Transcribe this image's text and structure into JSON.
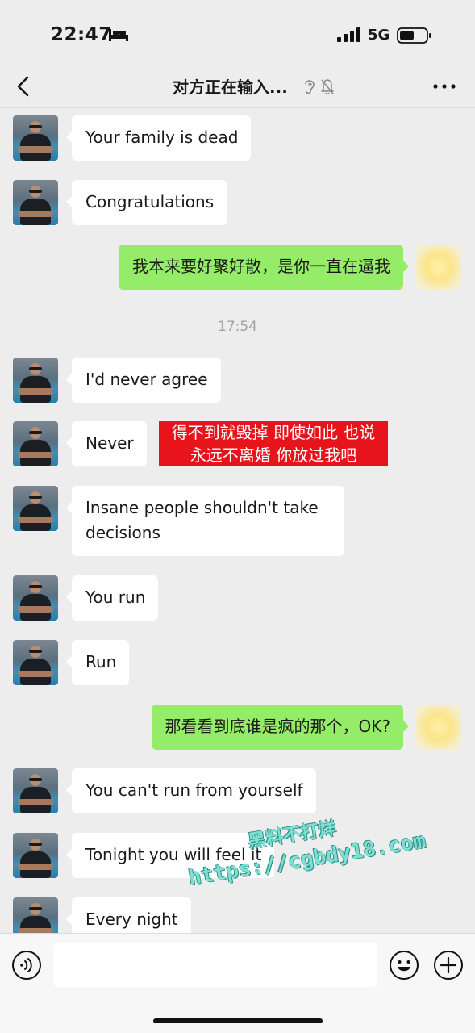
{
  "status_bar": {
    "time": "22:47",
    "network": "5G",
    "icons": [
      "bed-icon",
      "signal-icon",
      "battery-icon"
    ]
  },
  "nav": {
    "title": "对方正在输入...",
    "icons": [
      "back-icon",
      "ear-icon",
      "bell-mute-icon",
      "more-icon"
    ]
  },
  "messages": [
    {
      "side": "in",
      "text": "Your family is dead"
    },
    {
      "side": "in",
      "text": "Congratulations"
    },
    {
      "side": "out",
      "text": "我本来要好聚好散，是你一直在逼我"
    },
    {
      "side": "time",
      "text": "17:54"
    },
    {
      "side": "in",
      "text": "I'd never agree"
    },
    {
      "side": "in",
      "text": "Never"
    },
    {
      "side": "in",
      "text": "Insane people shouldn't take decisions"
    },
    {
      "side": "in",
      "text": "You run"
    },
    {
      "side": "in",
      "text": "Run"
    },
    {
      "side": "out",
      "text": "那看看到底谁是疯的那个，OK?"
    },
    {
      "side": "in",
      "text": "You can't run from yourself"
    },
    {
      "side": "in",
      "text": "Tonight you will feel it"
    },
    {
      "side": "in",
      "text": "Every night"
    }
  ],
  "overlay_caption": {
    "line1": "得不到就毁掉 即使如此 也说",
    "line2": "永远不离婚 你放过我吧"
  },
  "watermark": {
    "line1": "黑料不打烊",
    "line2": "https://cgbdy18.com"
  },
  "input_bar": {
    "placeholder": "",
    "icons": [
      "voice-icon",
      "emoji-icon",
      "plus-icon"
    ]
  },
  "colors": {
    "background": "#ededed",
    "incoming_bubble": "#ffffff",
    "outgoing_bubble": "#95ec69",
    "caption_red": "#e8141c",
    "timestamp": "#a3a3a3"
  }
}
